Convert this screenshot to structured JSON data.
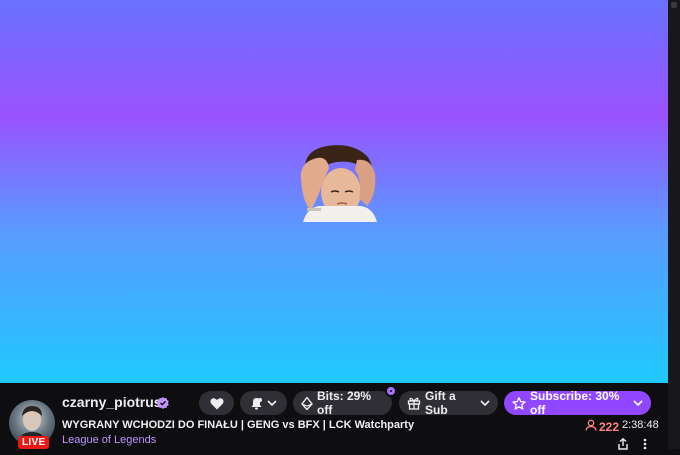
{
  "channel": {
    "name": "czarny_piotrus",
    "live_label": "LIVE",
    "stream_title": "WYGRANY WCHODZI DO FINAŁU | GENG vs BFX | LCK Watchparty",
    "category": "League of Legends"
  },
  "actions": {
    "bits_label": "Bits: 29% off",
    "gift_label": "Gift a Sub",
    "subscribe_label": "Subscribe: 30% off"
  },
  "stats": {
    "viewers": "222",
    "uptime": "2:38:48"
  },
  "colors": {
    "accent": "#9147ff",
    "live": "#e91916",
    "viewers": "#ff8280",
    "category": "#bf94ff"
  },
  "icons": {
    "verified": "verified-badge-icon",
    "follow": "heart-icon",
    "notify": "bell-icon",
    "bits": "bits-icon",
    "gift": "gift-icon",
    "subscribe": "star-icon",
    "viewers": "person-icon",
    "share": "share-icon",
    "more": "more-vertical-icon"
  }
}
